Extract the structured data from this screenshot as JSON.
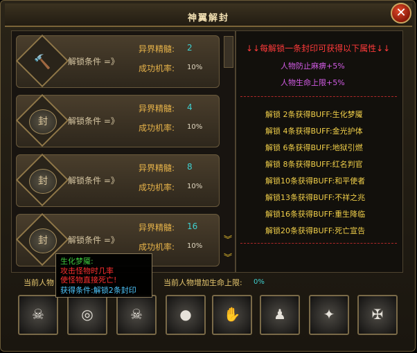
{
  "window": {
    "title": "神翼解封",
    "close_icon": "close-icon"
  },
  "unlock_cards": [
    {
      "icon": "hammer-icon",
      "condition": "解锁条件 =》",
      "material_label": "异界精髓:",
      "material_value": "2",
      "rate_label": "成功机率:",
      "rate_value": "10%"
    },
    {
      "icon": "seal-icon",
      "seal_char": "封",
      "condition": "解锁条件 =》",
      "material_label": "异界精髓:",
      "material_value": "4",
      "rate_label": "成功机率:",
      "rate_value": "10%"
    },
    {
      "icon": "seal-icon",
      "seal_char": "封",
      "condition": "解锁条件 =》",
      "material_label": "异界精髓:",
      "material_value": "8",
      "rate_label": "成功机率:",
      "rate_value": "10%"
    },
    {
      "icon": "seal-icon",
      "seal_char": "封",
      "condition": "解锁条件 =》",
      "material_label": "异界精髓:",
      "material_value": "16",
      "rate_label": "成功机率:",
      "rate_value": "10%"
    }
  ],
  "info": {
    "header": "↓↓每解锁一条封印可获得以下属性↓↓",
    "attributes": [
      "人物防止麻痹+5%",
      "人物生命上限+5%"
    ],
    "buffs": [
      "解锁 2条获得BUFF:生化梦魇",
      "解锁 4条获得BUFF:金光护体",
      "解锁 6条获得BUFF:地狱引燃",
      "解锁 8条获得BUFF:红名判官",
      "解锁10条获得BUFF:和平使者",
      "解锁13条获得BUFF:不祥之兆",
      "解锁16条获得BUFF:重生降临",
      "解锁20条获得BUFF:死亡宣告"
    ]
  },
  "status": {
    "left_label": "当前人物",
    "hp_label": "当前人物增加生命上限:",
    "hp_value": "0%"
  },
  "tooltip": {
    "title": "生化梦魇:",
    "line1": "攻击怪物时几率",
    "line2": "使怪物直接死亡!",
    "req": "获得条件:解锁2条封印"
  },
  "buff_slots": [
    "demon-face-icon",
    "swirl-icon",
    "skull-icon",
    "hooded-figure-icon",
    "handshake-icon",
    "shadow-figures-icon",
    "rebirth-icon",
    "death-icon"
  ]
}
